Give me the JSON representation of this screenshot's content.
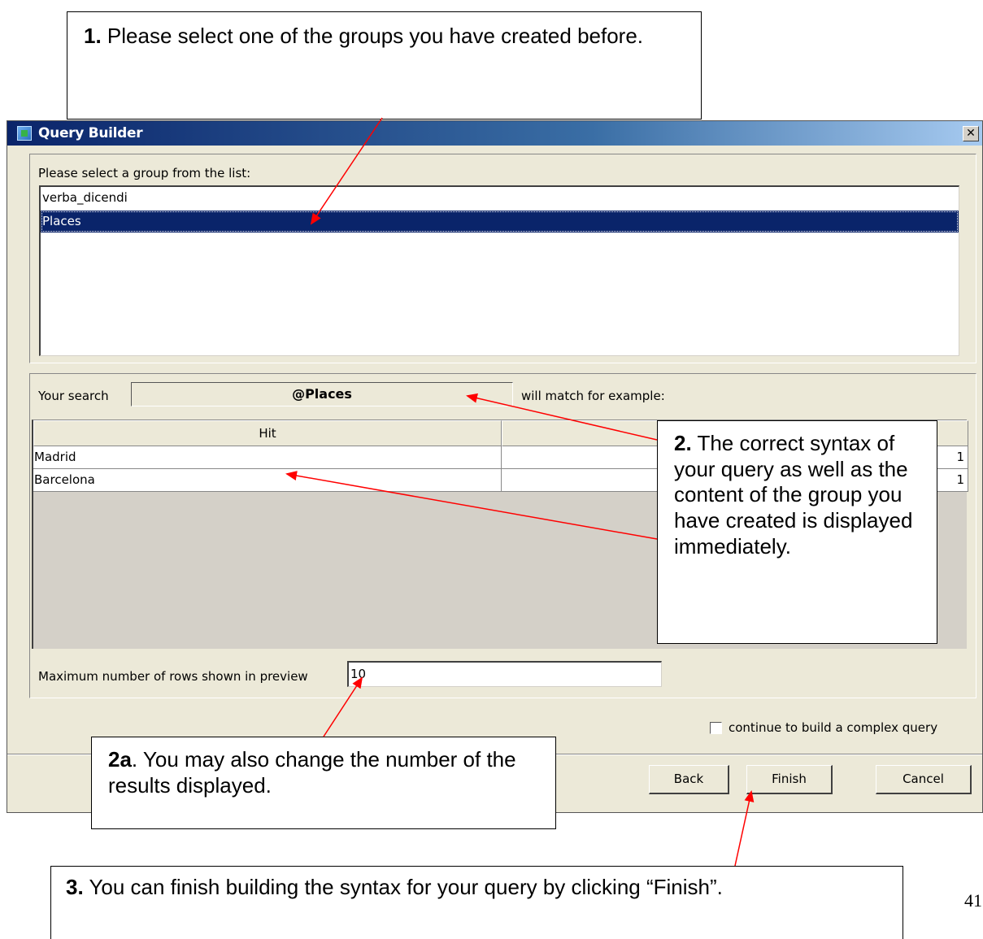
{
  "window": {
    "title": "Query Builder",
    "close_glyph": "✕"
  },
  "group_panel": {
    "label": "Please select a group from the list:",
    "items": [
      "verba_dicendi",
      "Places"
    ],
    "selected_index": 1
  },
  "preview_panel": {
    "search_label": "Your search",
    "search_value": "@Places",
    "match_label": "will match for example:",
    "table": {
      "headers": [
        "Hit",
        ""
      ],
      "rows": [
        {
          "hit": "Madrid",
          "count": "1"
        },
        {
          "hit": "Barcelona",
          "count": "1"
        }
      ]
    },
    "rows_label": "Maximum number of rows shown in preview",
    "rows_value": "10"
  },
  "checkbox": {
    "label": "continue to build a complex query",
    "checked": false
  },
  "buttons": {
    "back": "Back",
    "finish": "Finish",
    "cancel": "Cancel"
  },
  "callouts": {
    "c1": {
      "num": "1.",
      "text": " Please select one of the groups you have created before."
    },
    "c2": {
      "num": "2.",
      "text": " The correct syntax of your query as well as the content of the group you have created is displayed immediately."
    },
    "c2a": {
      "num": "2a",
      "text": ". You may also change the number of the results displayed."
    },
    "c3": {
      "num": "3.",
      "text": " You can finish building the syntax for your query by clicking “Finish”."
    }
  },
  "page_number": "41",
  "colors": {
    "arrow": "#ff0000",
    "selection": "#0a246a",
    "dialog_bg": "#ece9d8"
  }
}
